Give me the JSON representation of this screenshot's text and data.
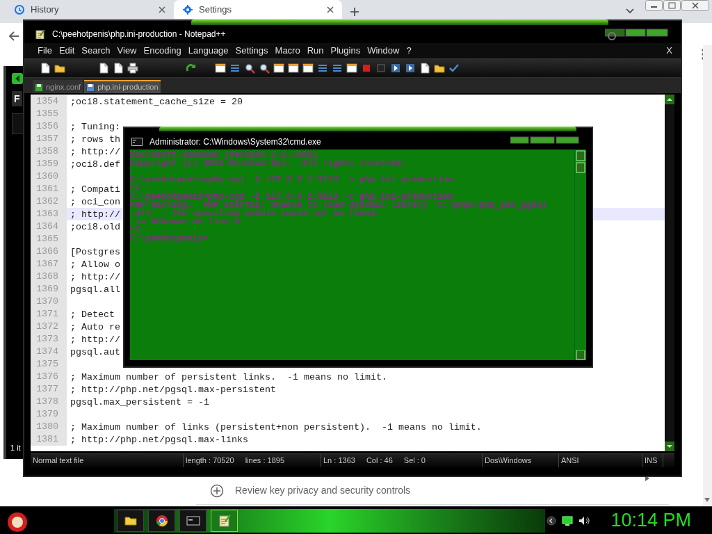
{
  "browser": {
    "tabs": [
      {
        "label": "History",
        "selected": false
      },
      {
        "label": "Settings",
        "selected": true
      }
    ],
    "page_row": "Review key privacy and security controls"
  },
  "background_window": {
    "button_label": "F",
    "status_text": "1 it"
  },
  "notepad": {
    "title": "C:\\peehotpenis\\php.ini-production - Notepad++",
    "menu": [
      "File",
      "Edit",
      "Search",
      "View",
      "Encoding",
      "Language",
      "Settings",
      "Macro",
      "Run",
      "Plugins",
      "Window",
      "?"
    ],
    "close_label": "X",
    "tabs": [
      {
        "label": "nginx.conf",
        "selected": false
      },
      {
        "label": "php.ini-production",
        "selected": true
      }
    ],
    "lines": [
      {
        "number": "1354",
        "text": ";oci8.statement_cache_size = 20",
        "selected": false
      },
      {
        "number": "1355",
        "selected": false
      },
      {
        "number": "1356",
        "text": "; Tuning:",
        "selected": false
      },
      {
        "number": "1357",
        "text": "; rows th",
        "selected": false
      },
      {
        "number": "1358",
        "text": "; http://",
        "selected": false
      },
      {
        "number": "1359",
        "text": ";oci8.def",
        "selected": false
      },
      {
        "number": "1360",
        "selected": false
      },
      {
        "number": "1361",
        "text": "; Compati",
        "selected": false
      },
      {
        "number": "1362",
        "text": "; oci_con",
        "selected": false
      },
      {
        "number": "1363",
        "text": "; http://",
        "selected": true
      },
      {
        "number": "1364",
        "text": ";oci8.old",
        "selected": false
      },
      {
        "number": "1365",
        "selected": false
      },
      {
        "number": "1366",
        "text": "[Postgres",
        "selected": false
      },
      {
        "number": "1367",
        "text": "; Allow o",
        "selected": false
      },
      {
        "number": "1368",
        "text": "; http://",
        "selected": false
      },
      {
        "number": "1369",
        "text": "pgsql.all",
        "selected": false
      },
      {
        "number": "1370",
        "selected": false
      },
      {
        "number": "1371",
        "text": "; Detect",
        "selected": false
      },
      {
        "number": "1372",
        "text": "; Auto re",
        "selected": false
      },
      {
        "number": "1373",
        "text": "; http://",
        "selected": false
      },
      {
        "number": "1374",
        "text": "pgsql.aut",
        "selected": false
      },
      {
        "number": "1375",
        "selected": false
      },
      {
        "number": "1376",
        "text": "; Maximum number of persistent links.  -1 means no limit.",
        "selected": false
      },
      {
        "number": "1377",
        "text": "; http://php.net/pgsql.max-persistent",
        "selected": false
      },
      {
        "number": "1378",
        "text": "pgsql.max_persistent = -1",
        "selected": false
      },
      {
        "number": "1379",
        "selected": false
      },
      {
        "number": "1380",
        "text": "; Maximum number of links (persistent+non persistent).  -1 means no limit.",
        "selected": false
      },
      {
        "number": "1381",
        "text": "; http://php.net/pgsql.max-links",
        "selected": false
      }
    ],
    "status_bar": [
      [
        "Normal text file"
      ],
      [
        "length : 70520",
        "lines : 1895"
      ],
      [
        "Ln : 1363",
        "Col : 46",
        "Sel : 0"
      ],
      [
        "Dos\\Windows"
      ],
      [
        "ANSI"
      ],
      [
        "INS"
      ]
    ]
  },
  "cmd": {
    "title": "Administrator: C:\\Windows\\System32\\cmd.exe",
    "lines": [
      {
        "text": "Microsoft Windows [Version 6.1.7601]"
      },
      {
        "text": "Copyright (c) 2012 Dilshad Sys.  All rights reserved."
      },
      {
        "text": "C:\\peehotpenis>php-cgi -b 127.0.0.1:9123 -c php.ini-production",
        "space_before": true
      },
      {
        "text": "^C"
      },
      {
        "text": "C:\\peehotpenis>php-cgi -b 127.0.0.1:9123 -c php.ini-production"
      },
      {
        "text": "PHP Warning:  PHP Startup: Unable to load dynamic library 'C:\\php5\\php_pdo_pgsql"
      },
      {
        "text": ".dll' - The specified module could not be found."
      },
      {
        "text": " in Unknown on line 0"
      },
      {
        "text": "^C"
      },
      {
        "text": "C:\\peehotpenis>"
      }
    ]
  },
  "taskbar": {
    "apps": [
      {
        "kind": "folder",
        "selected": false
      },
      {
        "kind": "browser",
        "selected": false
      },
      {
        "kind": "console",
        "selected": false
      },
      {
        "kind": "notepad",
        "selected": true
      }
    ],
    "clock": "10:14 PM"
  }
}
